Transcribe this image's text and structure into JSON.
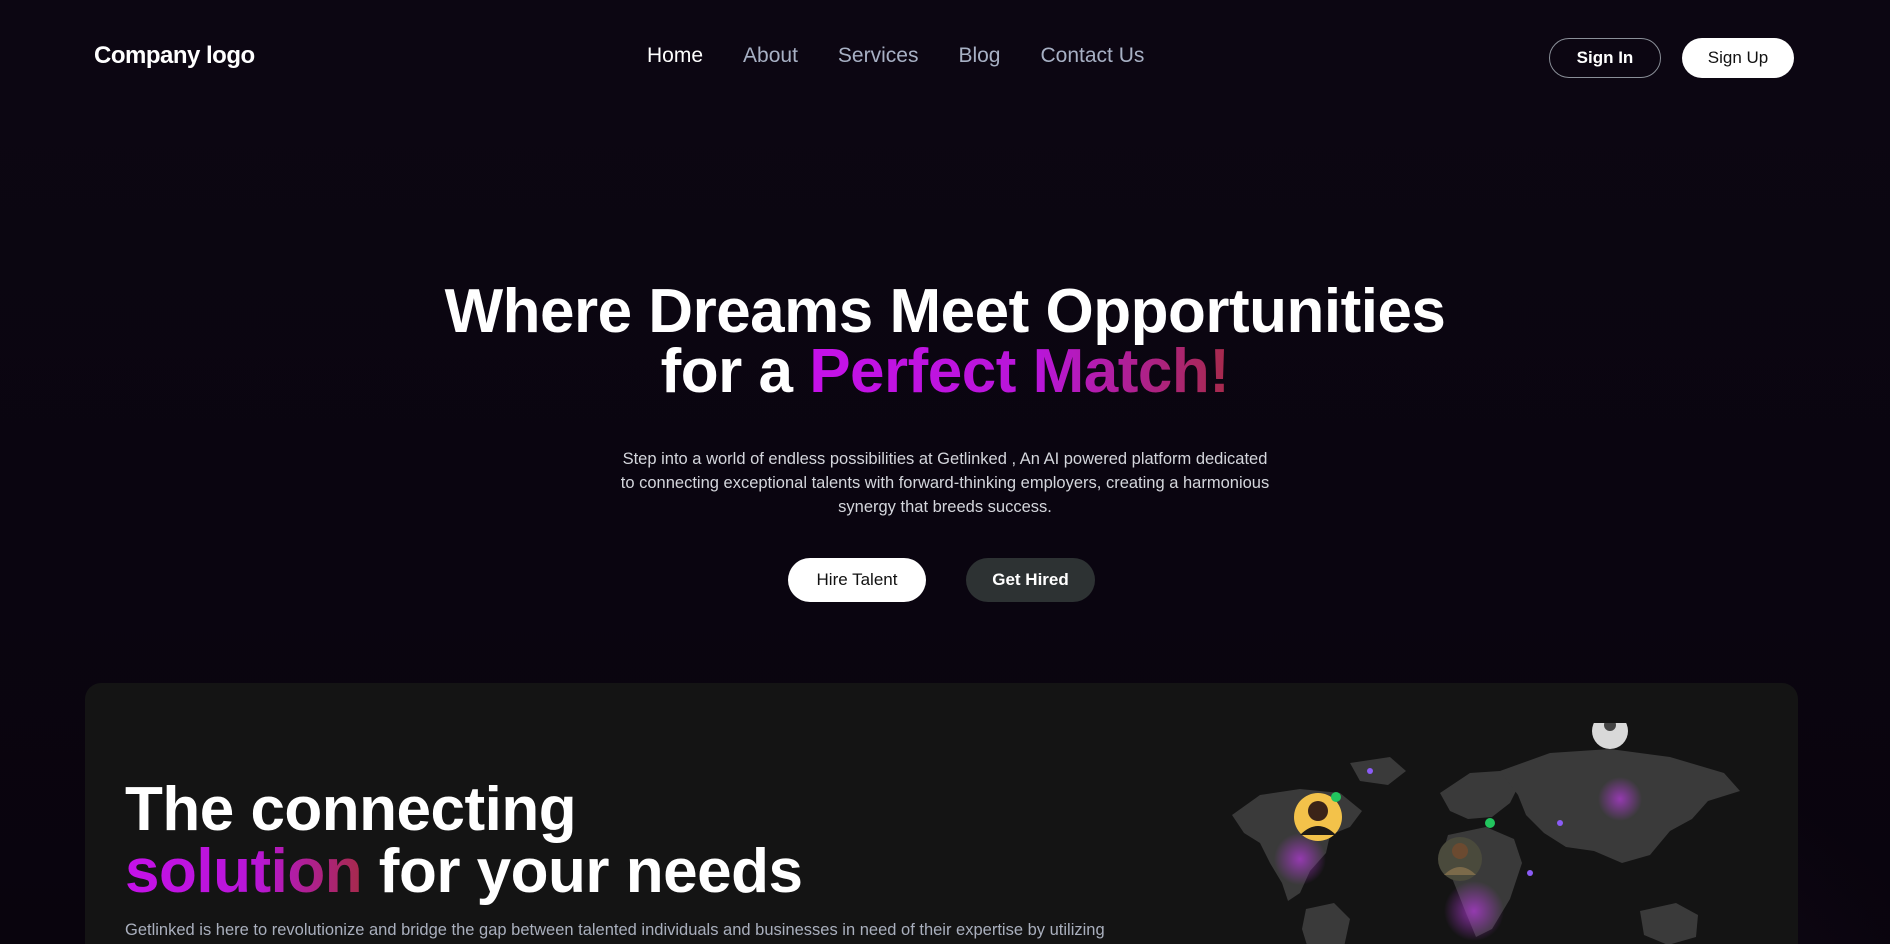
{
  "nav": {
    "logo": "Company logo",
    "links": [
      "Home",
      "About",
      "Services",
      "Blog",
      "Contact Us"
    ],
    "sign_in": "Sign In",
    "sign_up": "Sign Up"
  },
  "hero": {
    "title_line1": "Where Dreams Meet Opportunities",
    "title_line2_prefix": "for a ",
    "title_line2_highlight": "Perfect Match!",
    "subtitle_line1": "Step into a world of endless possibilities at Getlinked , An AI powered platform dedicated",
    "subtitle_line2": "to connecting exceptional talents with forward-thinking employers, creating a harmonious",
    "subtitle_line3": "synergy that breeds success.",
    "hire_talent": "Hire Talent",
    "get_hired": "Get Hired"
  },
  "section": {
    "title_line1": "The connecting",
    "title_line2_highlight": "solution",
    "title_line2_rest": " for your needs",
    "text": "Getlinked is here to revolutionize and bridge the gap between talented individuals and businesses in need of their expertise by utilizing"
  },
  "colors": {
    "accent_purple": "#c511e8",
    "accent_red": "#a62a4a",
    "background": "#0a0510",
    "card": "#141414",
    "online": "#22c55e"
  }
}
